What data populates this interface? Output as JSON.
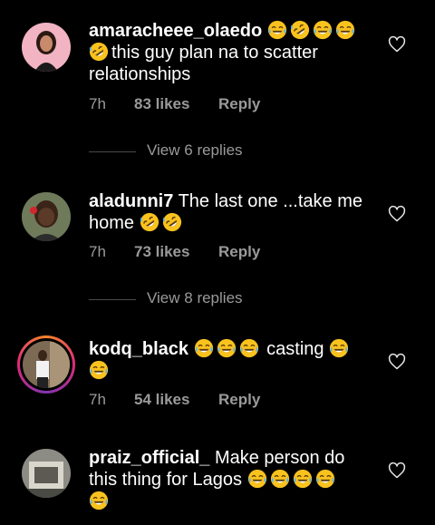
{
  "comments": [
    {
      "username": "amaracheee_olaedo",
      "line1": "this guy plan na to scatter",
      "line2": "relationships",
      "time": "7h",
      "likes": "83 likes",
      "reply": "Reply",
      "view_replies": "View 6 replies"
    },
    {
      "username": "aladunni7",
      "line1": "The last one ...take me",
      "line2": "home",
      "time": "7h",
      "likes": "73 likes",
      "reply": "Reply",
      "view_replies": "View 8 replies"
    },
    {
      "username": "kodq_black",
      "line1": "casting",
      "time": "7h",
      "likes": "54 likes",
      "reply": "Reply"
    },
    {
      "username": "praiz_official_",
      "line1": "Make person do",
      "line2": "this thing for Lagos"
    }
  ],
  "icons": {
    "like": "heart-outline-icon",
    "laugh": "face-with-tears-of-joy-emoji",
    "rofl": "rolling-on-the-floor-laughing-emoji"
  },
  "colors": {
    "background": "#000000",
    "text": "#ffffff",
    "secondary": "#9a9a9a",
    "emoji": "#f9c21d"
  }
}
